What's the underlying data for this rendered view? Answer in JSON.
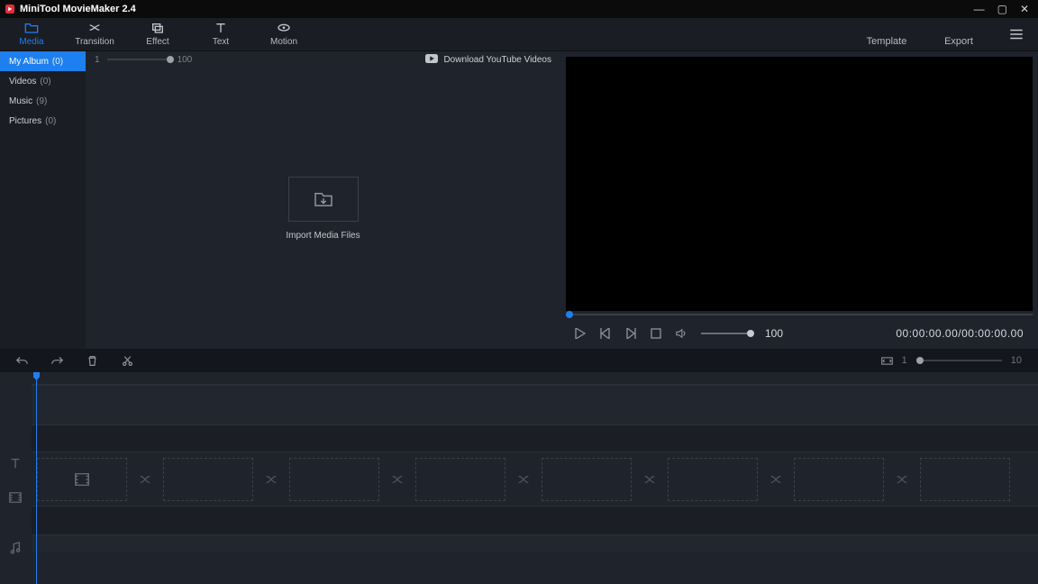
{
  "titlebar": {
    "title": "MiniTool MovieMaker 2.4"
  },
  "toolbar": {
    "items": [
      {
        "key": "media",
        "label": "Media"
      },
      {
        "key": "transition",
        "label": "Transition"
      },
      {
        "key": "effect",
        "label": "Effect"
      },
      {
        "key": "text",
        "label": "Text"
      },
      {
        "key": "motion",
        "label": "Motion"
      }
    ],
    "template_label": "Template",
    "export_label": "Export"
  },
  "sidebar": {
    "items": [
      {
        "label": "My Album",
        "count": "(0)"
      },
      {
        "label": "Videos",
        "count": "(0)"
      },
      {
        "label": "Music",
        "count": "(9)"
      },
      {
        "label": "Pictures",
        "count": "(0)"
      }
    ]
  },
  "media": {
    "zoom_min": "1",
    "zoom_max": "100",
    "download_label": "Download YouTube Videos",
    "import_label": "Import Media Files"
  },
  "preview": {
    "volume": "100",
    "time": "00:00:00.00/00:00:00.00"
  },
  "timeline_zoom": {
    "min": "1",
    "max": "10"
  }
}
